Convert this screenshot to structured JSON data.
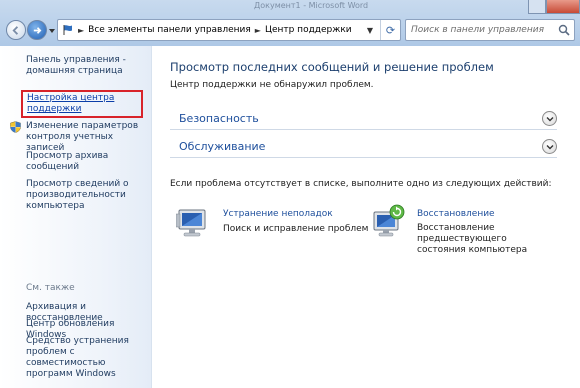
{
  "window": {
    "background_title": "Документ1 - Microsoft Word"
  },
  "address_bar": {
    "crumbs": [
      "Все элементы панели управления",
      "Центр поддержки"
    ],
    "separator": "►"
  },
  "search": {
    "placeholder": "Поиск в панели управления"
  },
  "sidebar": {
    "home": "Панель управления - домашняя страница",
    "settings_link": "Настройка центра поддержки",
    "uac": "Изменение параметров контроля учетных записей",
    "archived": "Просмотр архива сообщений",
    "performance": "Просмотр сведений о производительности компьютера",
    "see_also": "См. также",
    "backup": "Архивация и восстановление",
    "windows_update": "Центр обновления Windows",
    "compat": "Средство устранения проблем с совместимостью программ Windows"
  },
  "main": {
    "title": "Просмотр последних сообщений и решение проблем",
    "status": "Центр поддержки не обнаружил проблем.",
    "sections": [
      "Безопасность",
      "Обслуживание"
    ],
    "hint": "Если проблема отсутствует в списке, выполните одно из следующих действий:",
    "tasks": [
      {
        "name": "Устранение неполадок",
        "description": "Поиск и исправление проблем"
      },
      {
        "name": "Восстановление",
        "description": "Восстановление предшествующего состояния компьютера"
      }
    ]
  },
  "colors": {
    "link": "#1e4f9c",
    "highlight_border": "#d8232a",
    "chrome": "#b9d0ea"
  }
}
